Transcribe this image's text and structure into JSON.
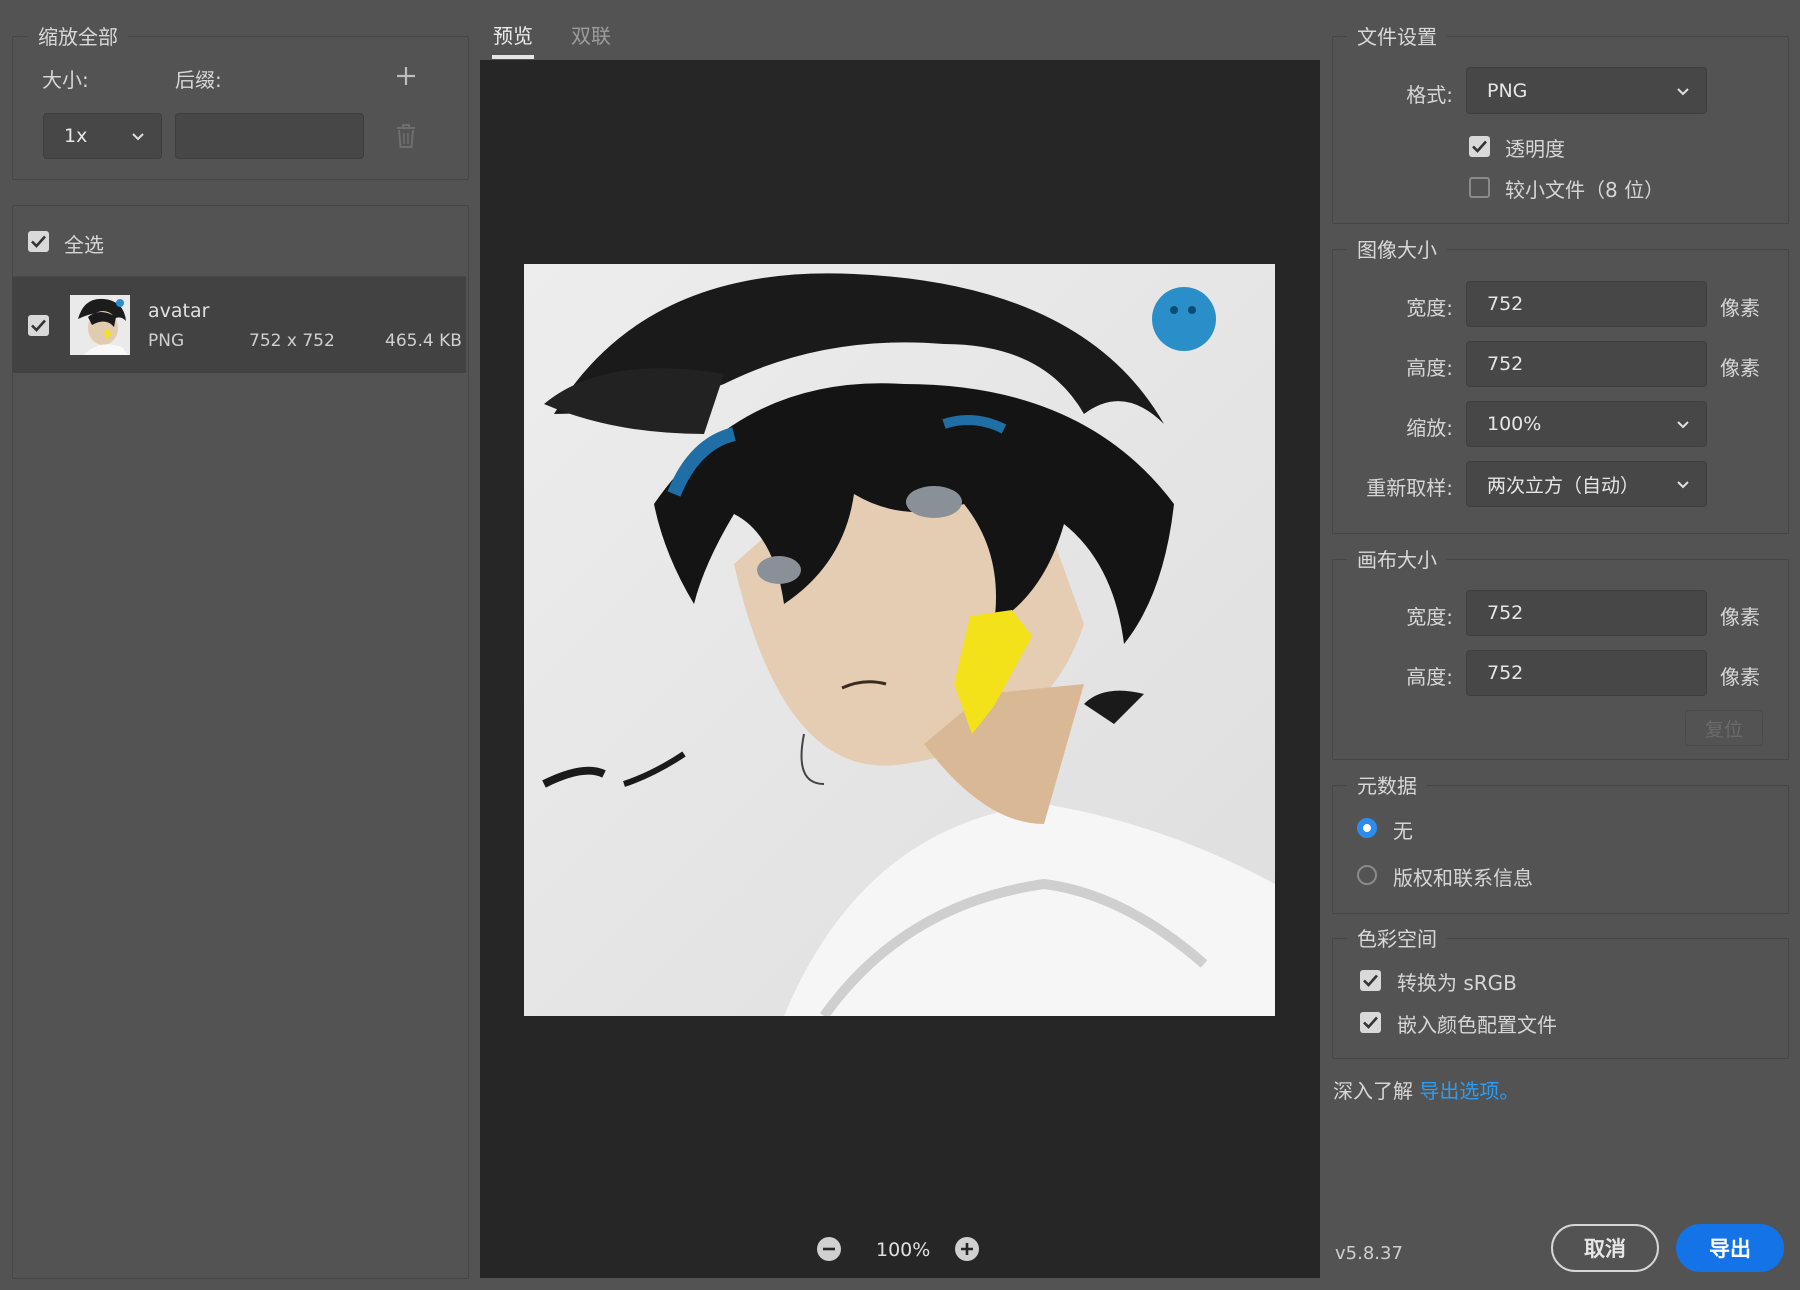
{
  "left": {
    "scale_all_title": "缩放全部",
    "size_label": "大小:",
    "suffix_label": "后缀:",
    "size_value": "1x",
    "suffix_value": "",
    "select_all_label": "全选",
    "asset": {
      "name": "avatar",
      "format": "PNG",
      "dimensions": "752 x 752",
      "filesize": "465.4 KB",
      "checked": true
    }
  },
  "center": {
    "tabs": [
      {
        "label": "预览",
        "active": true
      },
      {
        "label": "双联",
        "active": false
      }
    ],
    "zoom": "100%"
  },
  "right": {
    "file_settings": {
      "title": "文件设置",
      "format_label": "格式:",
      "format_value": "PNG",
      "transparency_label": "透明度",
      "transparency_checked": true,
      "smaller_file_label": "较小文件（8 位）",
      "smaller_file_checked": false
    },
    "image_size": {
      "title": "图像大小",
      "width_label": "宽度:",
      "width_value": "752",
      "height_label": "高度:",
      "height_value": "752",
      "scale_label": "缩放:",
      "scale_value": "100%",
      "resample_label": "重新取样:",
      "resample_value": "两次立方（自动）",
      "unit": "像素"
    },
    "canvas_size": {
      "title": "画布大小",
      "width_label": "宽度:",
      "width_value": "752",
      "height_label": "高度:",
      "height_value": "752",
      "unit": "像素",
      "reset_label": "复位"
    },
    "metadata": {
      "title": "元数据",
      "options": [
        {
          "label": "无",
          "selected": true
        },
        {
          "label": "版权和联系信息",
          "selected": false
        }
      ]
    },
    "color_space": {
      "title": "色彩空间",
      "convert_label": "转换为 sRGB",
      "convert_checked": true,
      "embed_label": "嵌入颜色配置文件",
      "embed_checked": true
    },
    "learn_more_prefix": "深入了解",
    "learn_more_link": "导出选项。"
  },
  "footer": {
    "version": "v5.8.37",
    "cancel_label": "取消",
    "export_label": "导出"
  },
  "colors": {
    "accent": "#1473e6",
    "link": "#2e9cf2",
    "panel_bg": "#535353",
    "preview_bg": "#262626",
    "selected_row": "#424242"
  }
}
